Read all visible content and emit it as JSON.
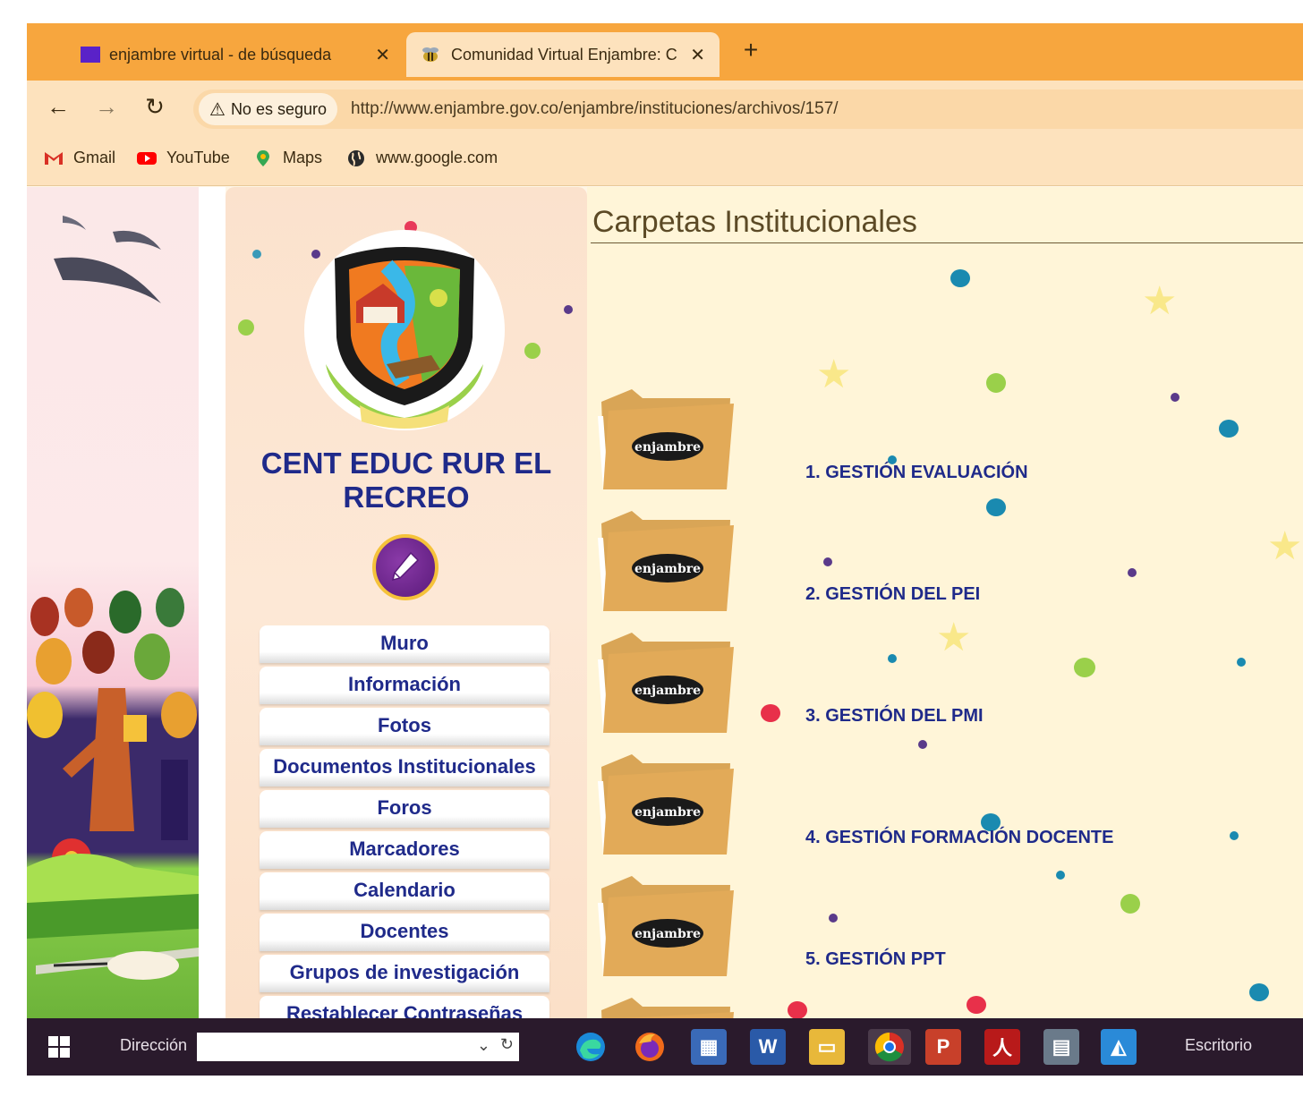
{
  "browser": {
    "tabs": [
      {
        "title": "enjambre virtual - de búsqueda",
        "close": "✕"
      },
      {
        "title": "Comunidad Virtual Enjambre: C",
        "close": "✕"
      }
    ],
    "new_tab": "+",
    "security_label": "No es seguro",
    "url": "http://www.enjambre.gov.co/enjambre/instituciones/archivos/157/",
    "bookmarks": [
      "Gmail",
      "YouTube",
      "Maps",
      "www.google.com"
    ]
  },
  "sidebar": {
    "school_name": "CENT EDUC RUR EL RECREO",
    "menu": [
      "Muro",
      "Información",
      "Fotos",
      "Documentos Institucionales",
      "Foros",
      "Marcadores",
      "Calendario",
      "Docentes",
      "Grupos de investigación",
      "Restablecer Contraseñas"
    ]
  },
  "content": {
    "title": "Carpetas Institucionales",
    "folder_badge": "enjambre",
    "folders": [
      "1. GESTIÓN EVALUACIÓN",
      "2. GESTIÓN DEL PEI",
      "3. GESTIÓN DEL PMI",
      "4. GESTIÓN FORMACIÓN DOCENTE",
      "5. GESTIÓN PPT"
    ]
  },
  "taskbar": {
    "address_label": "Dirección",
    "right_label": "Escritorio"
  },
  "colors": {
    "tab_strip": "#f7a63e",
    "toolbar": "#fde2bd",
    "nav_text": "#1f2a8a",
    "content_bg": "#fff5d8",
    "taskbar": "#2a1a2c"
  }
}
